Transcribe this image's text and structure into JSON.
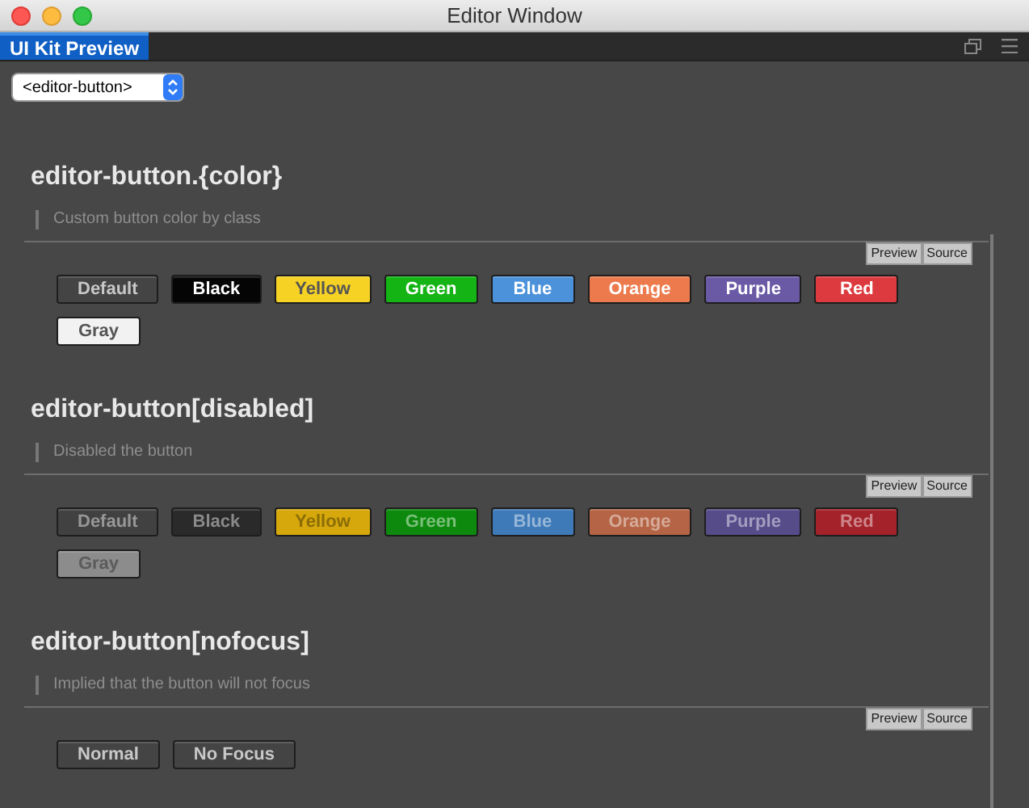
{
  "window": {
    "title": "Editor Window"
  },
  "tabs": [
    {
      "label": "UI Kit Preview",
      "selected": true
    }
  ],
  "component_select": {
    "value": "<editor-button>"
  },
  "sections": [
    {
      "title": "editor-button.{color}",
      "description": "Custom button color by class",
      "preview_label": "Preview",
      "source_label": "Source",
      "buttons": [
        {
          "label": "Default",
          "color": "#444444",
          "disabled": false
        },
        {
          "label": "Black",
          "color": "#050505",
          "disabled": false
        },
        {
          "label": "Yellow",
          "color": "#f5d223",
          "disabled": false
        },
        {
          "label": "Green",
          "color": "#13b413",
          "disabled": false
        },
        {
          "label": "Blue",
          "color": "#4b92da",
          "disabled": false
        },
        {
          "label": "Orange",
          "color": "#ec7a4c",
          "disabled": false
        },
        {
          "label": "Purple",
          "color": "#6a5aa5",
          "disabled": false
        },
        {
          "label": "Red",
          "color": "#dc3a3e",
          "disabled": false
        },
        {
          "label": "Gray",
          "color": "#f2f2f2",
          "disabled": false
        }
      ]
    },
    {
      "title": "editor-button[disabled]",
      "description": "Disabled the button",
      "preview_label": "Preview",
      "source_label": "Source",
      "buttons": [
        {
          "label": "Default",
          "color": "#414141",
          "disabled": true
        },
        {
          "label": "Black",
          "color": "#2a2a2a",
          "disabled": true
        },
        {
          "label": "Yellow",
          "color": "#d6a80c",
          "disabled": true
        },
        {
          "label": "Green",
          "color": "#0d8a0d",
          "disabled": true
        },
        {
          "label": "Blue",
          "color": "#3f7ab8",
          "disabled": true
        },
        {
          "label": "Orange",
          "color": "#b56546",
          "disabled": true
        },
        {
          "label": "Purple",
          "color": "#574c8a",
          "disabled": true
        },
        {
          "label": "Red",
          "color": "#a4222a",
          "disabled": true
        },
        {
          "label": "Gray",
          "color": "#8c8c8c",
          "disabled": true
        }
      ]
    },
    {
      "title": "editor-button[nofocus]",
      "description": "Implied that the button will not focus",
      "preview_label": "Preview",
      "source_label": "Source",
      "buttons": [
        {
          "label": "Normal",
          "color": "#444444",
          "disabled": false
        },
        {
          "label": "No Focus",
          "color": "#444444",
          "disabled": false
        }
      ]
    }
  ]
}
